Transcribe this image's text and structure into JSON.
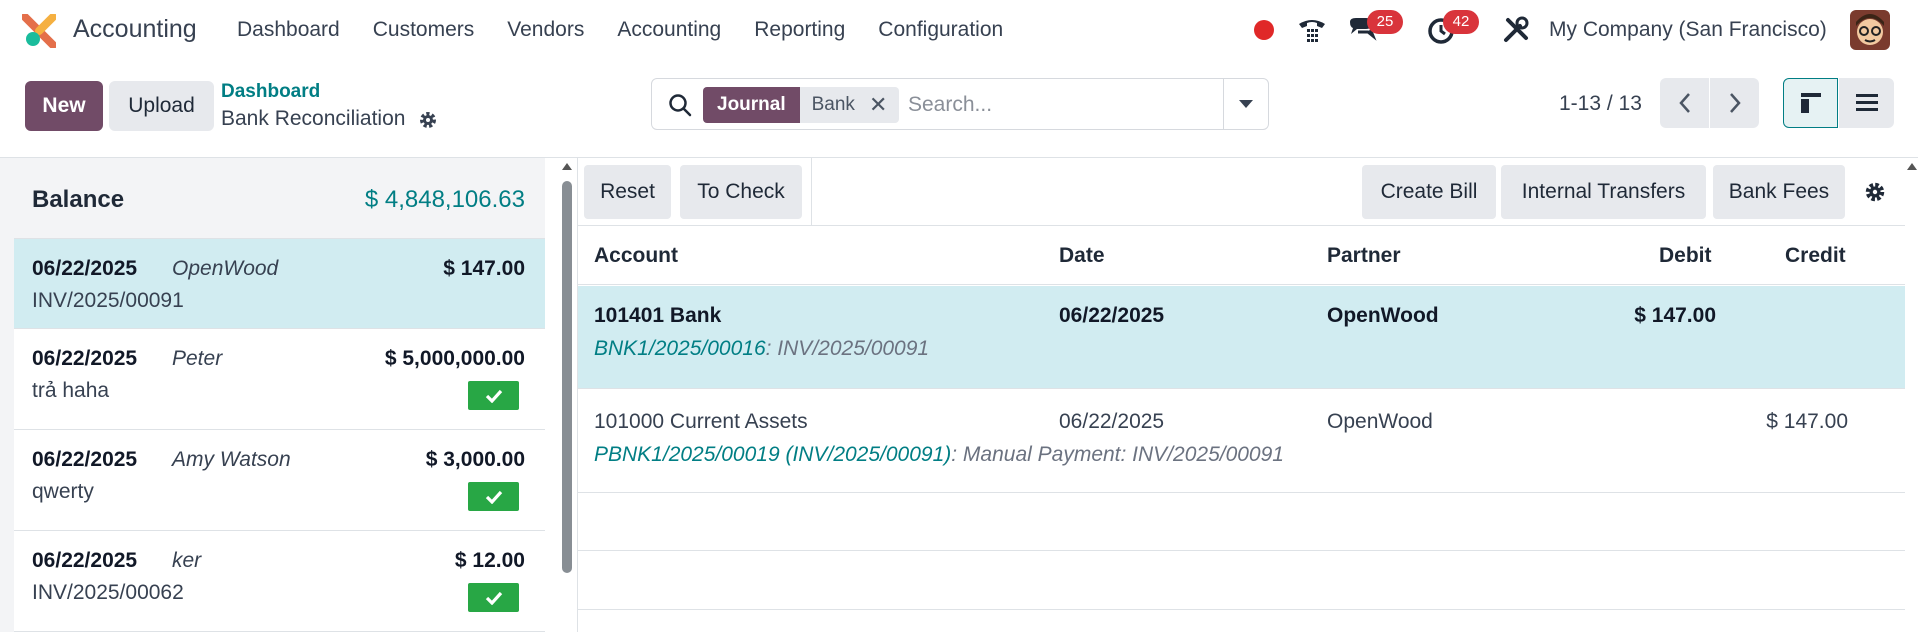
{
  "navbar": {
    "app_name": "Accounting",
    "menu": [
      "Dashboard",
      "Customers",
      "Vendors",
      "Accounting",
      "Reporting",
      "Configuration"
    ],
    "messages_badge": "25",
    "activities_badge": "42",
    "company": "My Company (San Francisco)"
  },
  "control_panel": {
    "new_label": "New",
    "upload_label": "Upload",
    "breadcrumb_parent": "Dashboard",
    "breadcrumb_current": "Bank Reconciliation",
    "search": {
      "facet_label": "Journal",
      "facet_value": "Bank",
      "placeholder": "Search..."
    },
    "pager": "1-13 / 13"
  },
  "left_panel": {
    "balance_label": "Balance",
    "balance_amount": "$ 4,848,106.63",
    "lines": [
      {
        "date": "06/22/2025",
        "partner": "OpenWood",
        "amount": "$ 147.00",
        "ref": "INV/2025/00091",
        "checked": false,
        "selected": true
      },
      {
        "date": "06/22/2025",
        "partner": "Peter",
        "amount": "$ 5,000,000.00",
        "ref": "trả haha",
        "checked": true,
        "selected": false
      },
      {
        "date": "06/22/2025",
        "partner": "Amy Watson",
        "amount": "$ 3,000.00",
        "ref": "qwerty",
        "checked": true,
        "selected": false
      },
      {
        "date": "06/22/2025",
        "partner": "ker",
        "amount": "$ 12.00",
        "ref": "INV/2025/00062",
        "checked": true,
        "selected": false
      }
    ]
  },
  "right_panel": {
    "toolbar": {
      "reset_label": "Reset",
      "to_check_label": "To Check",
      "create_bill_label": "Create Bill",
      "internal_transfers_label": "Internal Transfers",
      "bank_fees_label": "Bank Fees"
    },
    "columns": {
      "account": "Account",
      "date": "Date",
      "partner": "Partner",
      "debit": "Debit",
      "credit": "Credit"
    },
    "rows": [
      {
        "account": "101401 Bank",
        "date": "06/22/2025",
        "partner": "OpenWood",
        "debit": "$ 147.00",
        "credit": "",
        "link": "BNK1/2025/00016",
        "note": ": INV/2025/00091"
      },
      {
        "account": "101000 Current Assets",
        "date": "06/22/2025",
        "partner": "OpenWood",
        "debit": "",
        "credit": "$ 147.00",
        "link": "PBNK1/2025/00019 (INV/2025/00091)",
        "note": ": Manual Payment: INV/2025/00091"
      }
    ]
  },
  "colors": {
    "primary": "#714b67",
    "teal": "#017e84",
    "selected_row": "#d1ecf1",
    "check_green": "#28a745",
    "badge_red": "#d9343b"
  }
}
